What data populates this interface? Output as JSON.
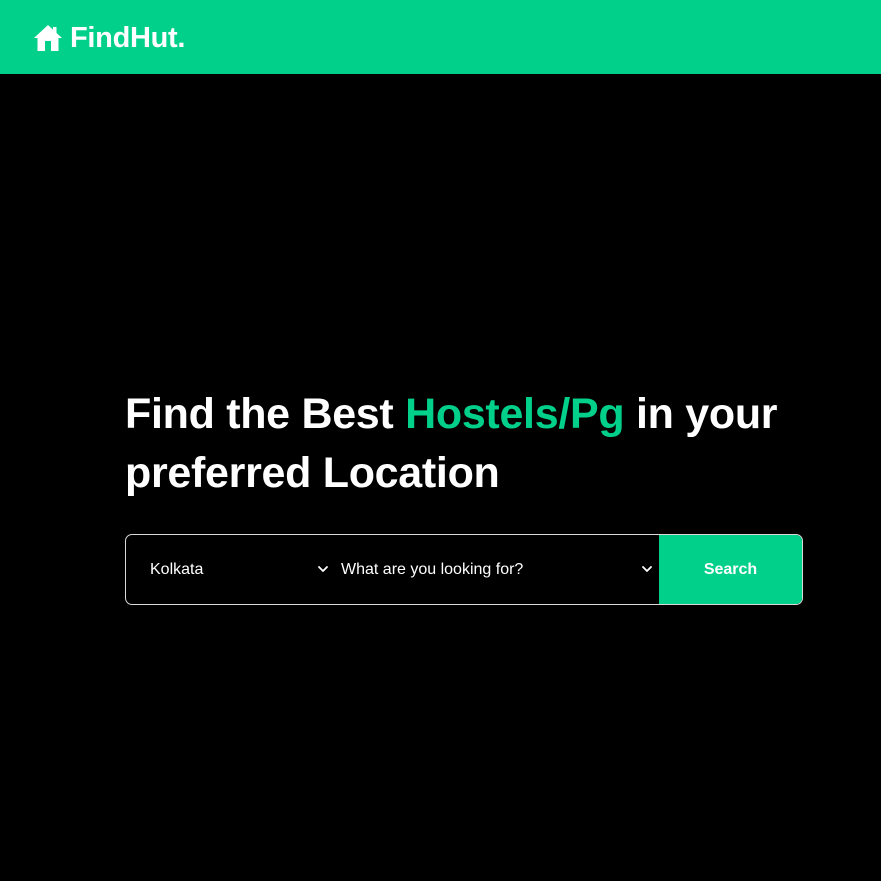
{
  "colors": {
    "accent": "#00d08a",
    "background": "#000000",
    "text": "#ffffff"
  },
  "navbar": {
    "brand_icon": "house-icon",
    "brand_name": "FindHut."
  },
  "hero": {
    "title_part1": "Find the Best ",
    "title_accent": "Hostels/Pg",
    "title_part2": " in your preferred Location"
  },
  "search": {
    "location_value": "Kolkata",
    "type_value": "What are you looking for?",
    "button_label": "Search",
    "dropdown_icon": "chevron-down-icon"
  }
}
